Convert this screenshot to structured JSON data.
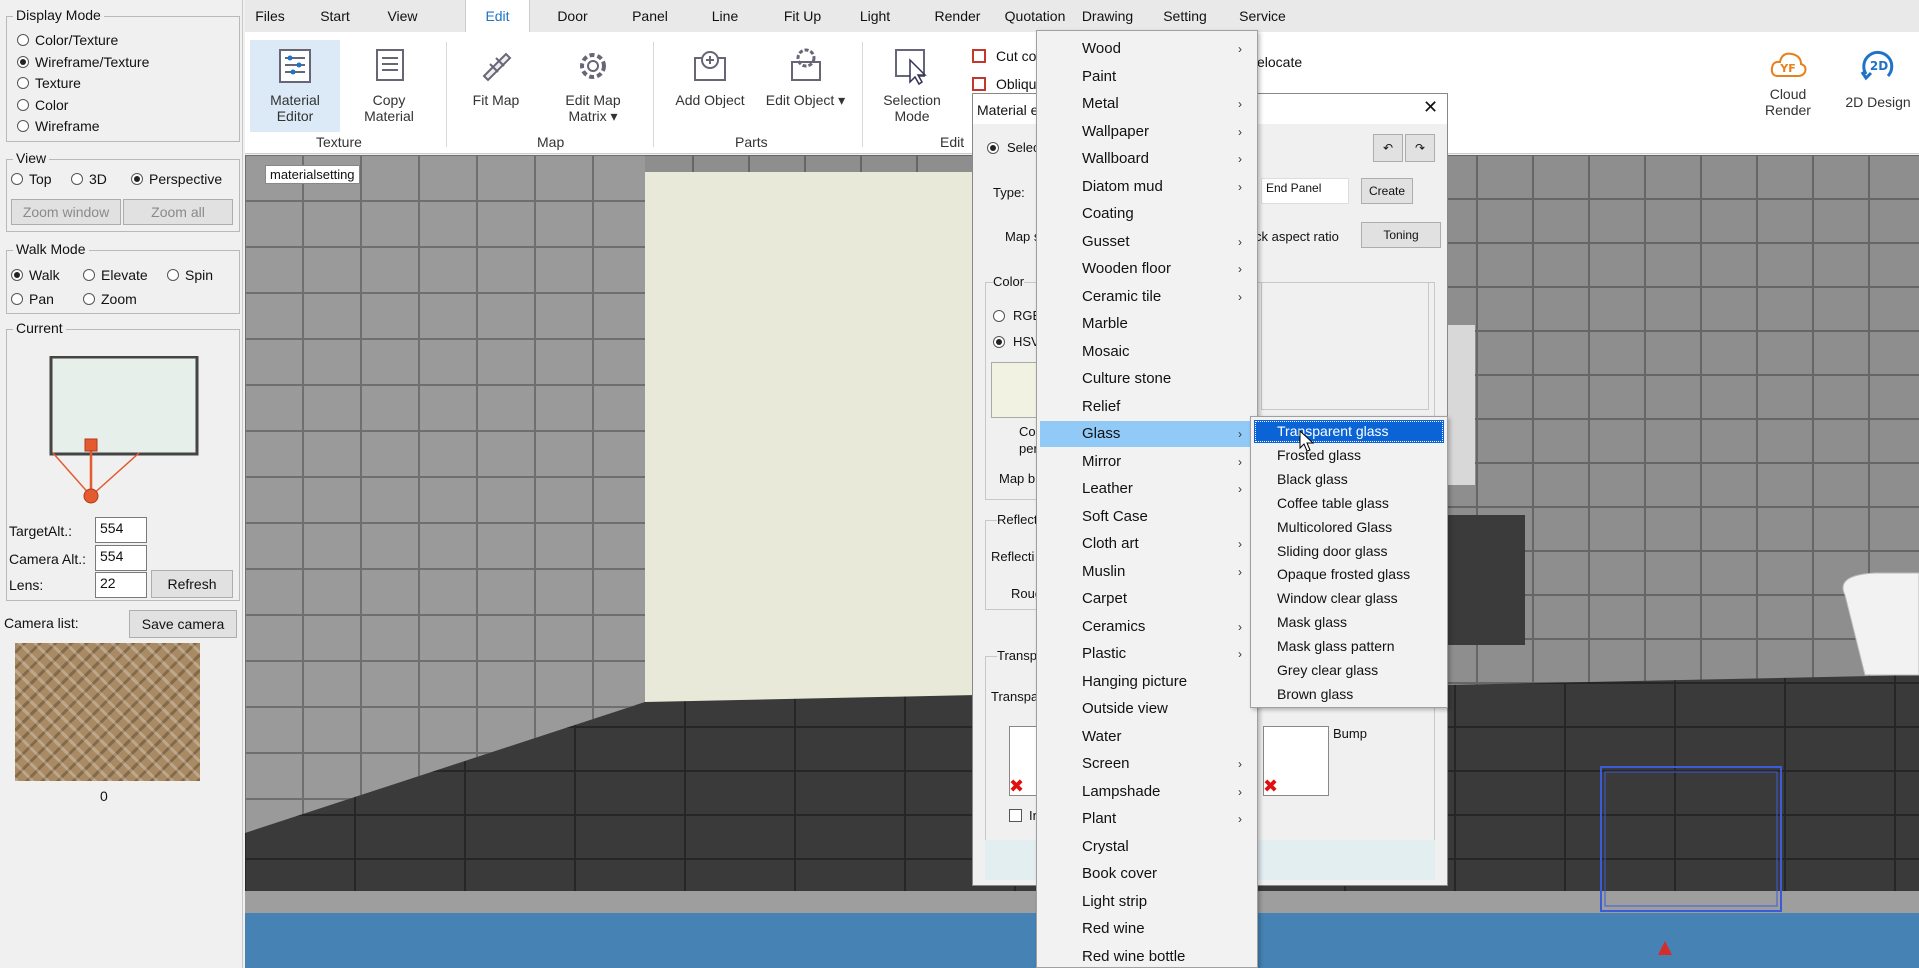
{
  "left_panel": {
    "display_mode": {
      "title": "Display Mode",
      "options": [
        "Color/Texture",
        "Wireframe/Texture",
        "Texture",
        "Color",
        "Wireframe"
      ],
      "selected": "Wireframe/Texture"
    },
    "view": {
      "title": "View",
      "options": [
        "Top",
        "3D",
        "Perspective"
      ],
      "selected": "Perspective",
      "zoom_window": "Zoom window",
      "zoom_all": "Zoom all"
    },
    "walk_mode": {
      "title": "Walk Mode",
      "options": [
        "Walk",
        "Elevate",
        "Spin",
        "Pan",
        "Zoom"
      ],
      "selected": "Walk"
    },
    "current": {
      "title": "Current",
      "target_alt_label": "TargetAlt.:",
      "target_alt": "554",
      "camera_alt_label": "Camera Alt.:",
      "camera_alt": "554",
      "lens_label": "Lens:",
      "lens": "22",
      "refresh": "Refresh"
    },
    "camera_list_label": "Camera list:",
    "save_camera": "Save camera",
    "camera_count": "0"
  },
  "menubar": {
    "tabs": [
      "Files",
      "Start",
      "View",
      "Edit",
      "Door",
      "Panel",
      "Line",
      "Fit Up",
      "Light",
      "Render",
      "Quotation",
      "Drawing",
      "Setting",
      "Service"
    ],
    "active": "Edit"
  },
  "ribbon": {
    "buttons": [
      {
        "label1": "Material",
        "label2": "Editor"
      },
      {
        "label1": "Copy",
        "label2": "Material"
      },
      {
        "label1": "Fit Map",
        "label2": ""
      },
      {
        "label1": "Edit Map",
        "label2": "Matrix ▾"
      },
      {
        "label1": "Add Object",
        "label2": ""
      },
      {
        "label1": "Edit Object ▾",
        "label2": ""
      },
      {
        "label1": "Selection",
        "label2": "Mode"
      }
    ],
    "small_buttons": [
      "Cut co",
      "Obliqu",
      "elocate"
    ],
    "groups": [
      "Texture",
      "Map",
      "Parts",
      "Edit"
    ],
    "right_buttons": [
      {
        "label1": "Cloud",
        "label2": "Render",
        "logo": "YF"
      },
      {
        "label1": "2D Design",
        "label2": "",
        "logo": "2D"
      }
    ]
  },
  "viewport": {
    "tag": "materialsetting"
  },
  "dialog": {
    "title": "Material e",
    "select_label": "Selec",
    "type_label": "Type:",
    "type_value": "End Panel",
    "create": "Create",
    "map_label": "Map s",
    "aspect_label": "ck aspect ratio",
    "toning": "Toning",
    "color_group": "Color",
    "rgb": "RGB",
    "hsv": "HSV",
    "col_label": "Col",
    "per_label": "per",
    "map_b_label": "Map b",
    "reflect_group": "Reflect",
    "reflecti_label": "Reflecti",
    "roug_label": "Roug",
    "transp_group": "Transp",
    "transpa_label": "Transpa",
    "bump_label": "Bump",
    "in_label": "In"
  },
  "menu": {
    "items": [
      {
        "label": "Wood",
        "sub": true
      },
      {
        "label": "Paint",
        "sub": false
      },
      {
        "label": "Metal",
        "sub": true
      },
      {
        "label": "Wallpaper",
        "sub": true
      },
      {
        "label": "Wallboard",
        "sub": true
      },
      {
        "label": "Diatom mud",
        "sub": true
      },
      {
        "label": "Coating",
        "sub": false
      },
      {
        "label": "Gusset",
        "sub": true
      },
      {
        "label": "Wooden floor",
        "sub": true
      },
      {
        "label": "Ceramic tile",
        "sub": true
      },
      {
        "label": "Marble",
        "sub": false
      },
      {
        "label": "Mosaic",
        "sub": false
      },
      {
        "label": "Culture stone",
        "sub": false
      },
      {
        "label": "Relief",
        "sub": false
      },
      {
        "label": "Glass",
        "sub": true
      },
      {
        "label": "Mirror",
        "sub": true
      },
      {
        "label": "Leather",
        "sub": true
      },
      {
        "label": "Soft Case",
        "sub": false
      },
      {
        "label": "Cloth art",
        "sub": true
      },
      {
        "label": "Muslin",
        "sub": true
      },
      {
        "label": "Carpet",
        "sub": false
      },
      {
        "label": "Ceramics",
        "sub": true
      },
      {
        "label": "Plastic",
        "sub": true
      },
      {
        "label": "Hanging picture",
        "sub": false
      },
      {
        "label": "Outside view",
        "sub": false
      },
      {
        "label": "Water",
        "sub": false
      },
      {
        "label": "Screen",
        "sub": true
      },
      {
        "label": "Lampshade",
        "sub": true
      },
      {
        "label": "Plant",
        "sub": true
      },
      {
        "label": "Crystal",
        "sub": false
      },
      {
        "label": "Book cover",
        "sub": false
      },
      {
        "label": "Light strip",
        "sub": false
      },
      {
        "label": "Red wine",
        "sub": false
      },
      {
        "label": "Red wine bottle",
        "sub": false
      }
    ],
    "highlighted": "Glass",
    "arrow": "›"
  },
  "submenu": {
    "items": [
      "Transparent glass",
      "Frosted glass",
      "Black glass",
      "Coffee table glass",
      "Multicolored Glass",
      "Sliding door glass",
      "Opaque frosted glass",
      "Window clear glass",
      "Mask glass",
      "Mask glass pattern",
      "Grey clear glass",
      "Brown glass"
    ],
    "selected": "Transparent glass"
  },
  "colors": {
    "accent": "#1e73c8",
    "menu_highlight": "#91c9f7",
    "submenu_selected": "#0a64d6",
    "floor_blue": "#4682b4"
  }
}
